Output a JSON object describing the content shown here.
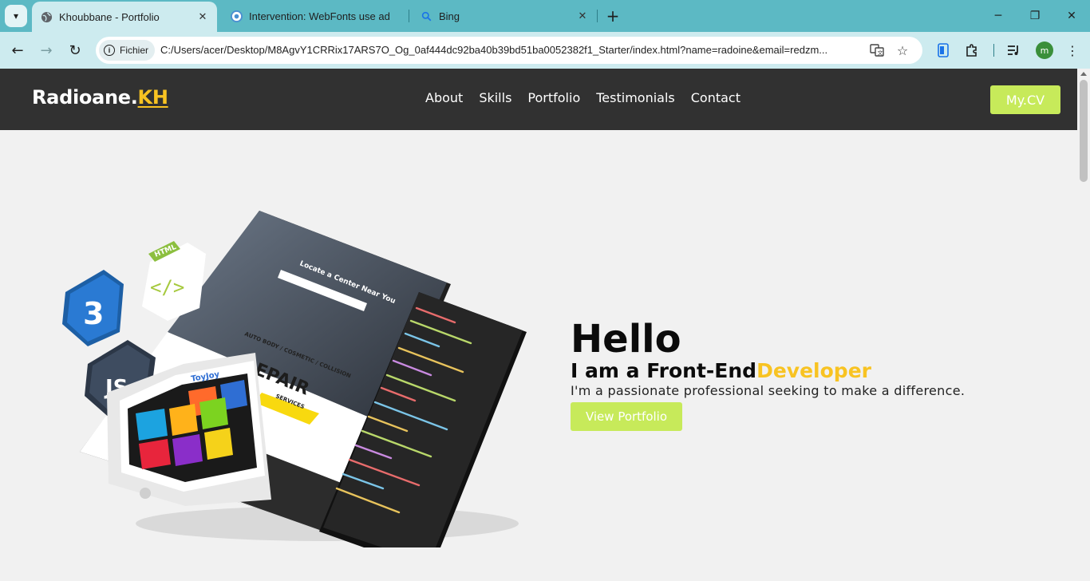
{
  "browser": {
    "tabs": [
      {
        "title": "Khoubbane - Portfolio",
        "active": true,
        "favicon": "globe-icon"
      },
      {
        "title": "Intervention: WebFonts use ad",
        "active": false,
        "favicon": "chrome-icon"
      },
      {
        "title": "Bing",
        "active": false,
        "favicon": "search-icon"
      }
    ],
    "site_chip_label": "Fichier",
    "url": "C:/Users/acer/Desktop/M8AgvY1CRRix17ARS7O_Og_0af444dc92ba40b39bd51ba0052382f1_Starter/index.html?name=radoine&email=redzm...",
    "profile_initial": "m"
  },
  "site": {
    "logo_main": "Radioane.",
    "logo_accent": "KH",
    "nav": [
      "About",
      "Skills",
      "Portfolio",
      "Testimonials",
      "Contact"
    ],
    "cv_button": "My.CV"
  },
  "hero": {
    "greeting": "Hello",
    "role_prefix": "I am a Front-End",
    "role_accent": "Developer",
    "tagline": "I'm a passionate professional seeking to make a difference.",
    "cta": "View Portfolio",
    "art": {
      "html_badge": "HTML",
      "js_badge": "JS",
      "screen_heading": "Locate a Center Near You",
      "screen_repair": "REPAIR",
      "screen_banner": "AUTO BODY / COSMETIC / COLLISION",
      "screen_services": "SERVICES",
      "phone_brand": "ToyJoy"
    }
  },
  "colors": {
    "accent_yellow": "#f8c322",
    "accent_green": "#c7ea5a",
    "nav_bg": "#313131",
    "page_bg": "#f1f1f1"
  }
}
